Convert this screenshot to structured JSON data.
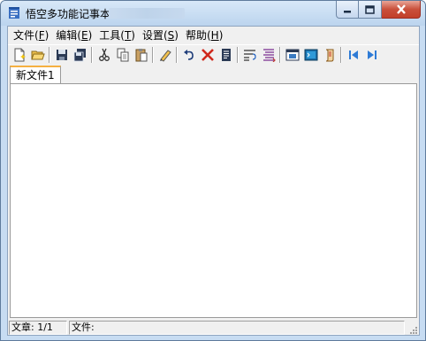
{
  "window": {
    "title": "悟空多功能记事本",
    "title_suffix_redacted": "",
    "app_icon": "notepad-app-icon",
    "controls": {
      "minimize_icon": "minimize-icon",
      "maximize_icon": "maximize-icon",
      "close_icon": "close-icon"
    }
  },
  "menu": [
    {
      "name": "menu-file",
      "label": "文件(",
      "accel": "F",
      "suffix": ")"
    },
    {
      "name": "menu-edit",
      "label": "编辑(",
      "accel": "E",
      "suffix": ")"
    },
    {
      "name": "menu-tools",
      "label": "工具(",
      "accel": "T",
      "suffix": ")"
    },
    {
      "name": "menu-settings",
      "label": "设置(",
      "accel": "S",
      "suffix": ")"
    },
    {
      "name": "menu-help",
      "label": "帮助(",
      "accel": "H",
      "suffix": ")"
    }
  ],
  "toolbar": {
    "icons": [
      "new-file-icon",
      "open-folder-icon",
      "save-icon",
      "save-all-icon",
      "cut-icon",
      "copy-icon",
      "paste-icon",
      "find-icon",
      "undo-icon",
      "delete-icon",
      "document-icon",
      "word-wrap-icon",
      "line-numbers-icon",
      "window-icon",
      "terminal-icon",
      "script-icon",
      "previous-icon",
      "next-icon"
    ]
  },
  "tabs": [
    {
      "label": "新文件1",
      "active": true
    }
  ],
  "editor": {
    "content": ""
  },
  "status": {
    "article": "文章: 1/1",
    "file": "文件:"
  },
  "colors": {
    "title_bar": "#bcd4ee",
    "close_button": "#c9503b",
    "tab_accent": "#f5b041",
    "client_bg": "#f0f0f0"
  }
}
